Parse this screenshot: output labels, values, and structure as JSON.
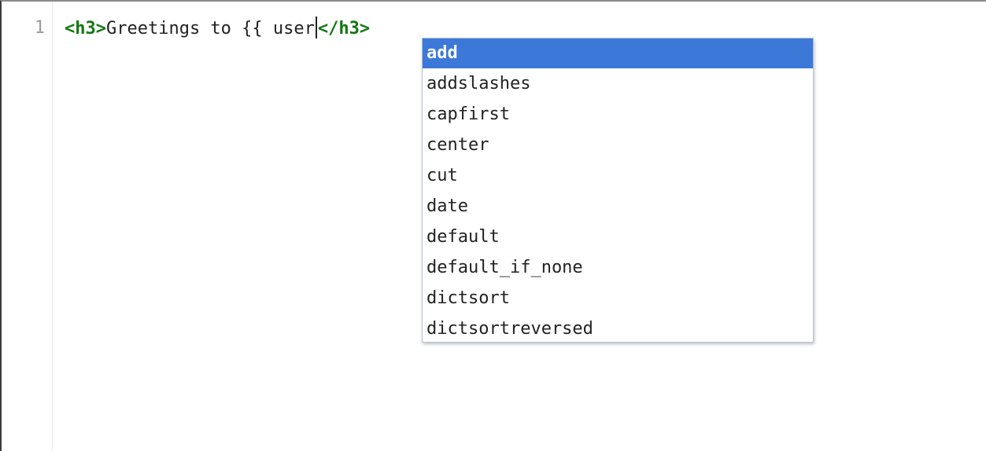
{
  "editor": {
    "line_number": "1",
    "code": {
      "open_tag": "<h3>",
      "text": "Greetings to {{ user",
      "close_tag": "</h3>"
    }
  },
  "autocomplete": {
    "selected_index": 0,
    "items": [
      "add",
      "addslashes",
      "capfirst",
      "center",
      "cut",
      "date",
      "default",
      "default_if_none",
      "dictsort",
      "dictsortreversed"
    ]
  },
  "colors": {
    "tag": "#117711",
    "selection": "#3b78d8"
  }
}
